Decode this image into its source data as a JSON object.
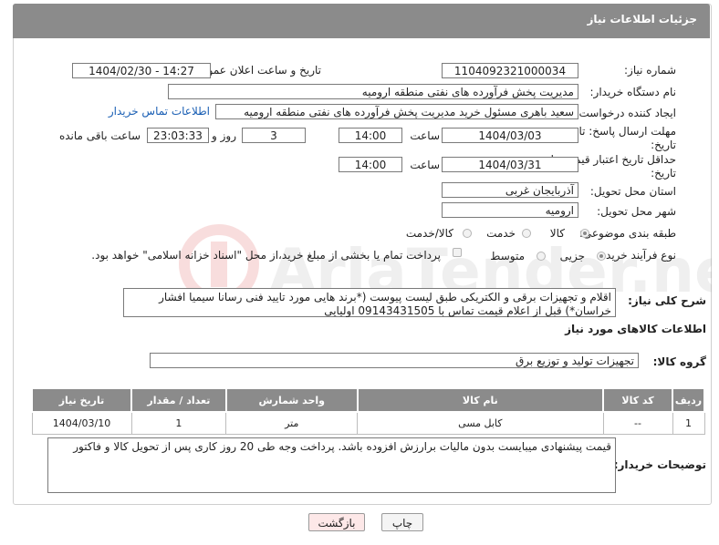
{
  "header": {
    "title": "جزئیات اطلاعات نیاز"
  },
  "need_number": {
    "label": "شماره نیاز:",
    "value": "1104092321000034"
  },
  "announce": {
    "label": "تاریخ و ساعت اعلان عمومی:",
    "value": "1404/02/30 - 14:27"
  },
  "buyer_org": {
    "label": "نام دستگاه خریدار:",
    "value": "مدیریت پخش فرآورده های نفتی منطقه ارومیه"
  },
  "requester": {
    "label": "ایجاد کننده درخواست:",
    "value": "سعید باهری مسئول خرید مدیریت پخش فرآورده های نفتی منطقه ارومیه",
    "contact_link": "اطلاعات تماس خریدار"
  },
  "send_deadline": {
    "label": "مهلت ارسال پاسخ: تا تاریخ:",
    "date": "1404/03/03",
    "time_label": "ساعت",
    "time": "14:00",
    "days": "3",
    "days_label": "روز و",
    "remaining": "23:03:33",
    "remaining_label": "ساعت باقی مانده"
  },
  "price_validity": {
    "label": "حداقل تاریخ اعتبار قیمت: تا تاریخ:",
    "date": "1404/03/31",
    "time_label": "ساعت",
    "time": "14:00"
  },
  "province": {
    "label": "استان محل تحویل:",
    "value": "آذربایجان غربی"
  },
  "city": {
    "label": "شهر محل تحویل:",
    "value": "ارومیه"
  },
  "category": {
    "label": "طبقه بندی موضوعی:",
    "options": [
      "کالا",
      "خدمت",
      "کالا/خدمت"
    ]
  },
  "process": {
    "label": "نوع فرآیند خرید :",
    "options": [
      "جزیی",
      "متوسط"
    ],
    "note": "پرداخت تمام یا بخشی از مبلغ خرید،از محل \"اسناد خزانه اسلامی\" خواهد بود."
  },
  "general_desc": {
    "label": "شرح کلی نیاز:",
    "value": "اقلام و تجهیزات برقی و الکتریکی طبق لیست پیوست (*برند هایی مورد تایید فنی رسانا سیمیا افشار خراسان*) قبل از اعلام قیمت تماس با 09143431505 اولیایی"
  },
  "goods_info": {
    "title": "اطلاعات کالاهای مورد نیاز"
  },
  "goods_group": {
    "label": "گروه کالا:",
    "value": "تجهیزات تولید و توزیع برق"
  },
  "table": {
    "headers": [
      "ردیف",
      "کد کالا",
      "نام کالا",
      "واحد شمارش",
      "تعداد / مقدار",
      "تاریخ نیاز"
    ],
    "rows": [
      [
        "1",
        "--",
        "کابل مسی",
        "متر",
        "1",
        "1404/03/10"
      ]
    ]
  },
  "buyer_notes": {
    "label": "توضیحات خریدار:",
    "value": "قیمت پیشنهادی میبایست بدون مالیات برارزش افزوده باشد. پرداخت وجه طی 20 روز کاری پس از تحویل کالا و فاکتور"
  },
  "buttons": {
    "print": "چاپ",
    "back": "بازگشت"
  },
  "watermark": {
    "text": "AriaTender.neT"
  },
  "colors": {
    "header_bg": "#8b8b8b",
    "link": "#1a5fb4",
    "back_btn_bg": "#fde8e8"
  }
}
